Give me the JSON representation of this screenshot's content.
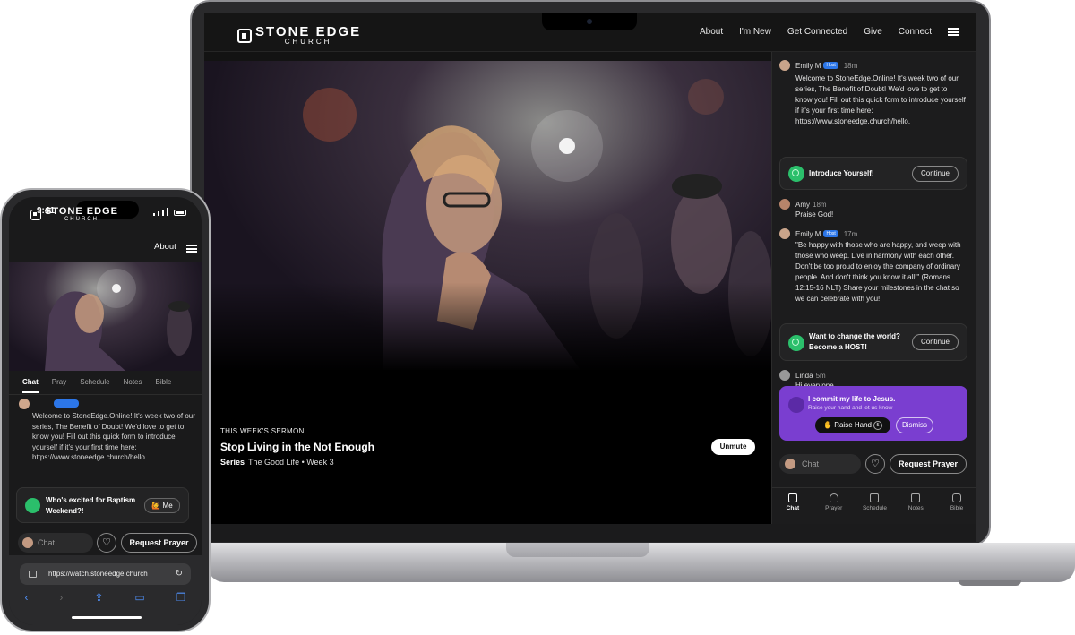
{
  "desktop": {
    "logo": {
      "line1": "STONE EDGE",
      "line2": "CHURCH"
    },
    "nav": [
      "About",
      "I'm New",
      "Get Connected",
      "Give",
      "Connect"
    ],
    "video": {
      "kicker": "THIS WEEK'S SERMON",
      "title": "Stop Living in the Not Enough",
      "series_label": "Series",
      "series_value": "The Good Life • Week 3",
      "unmute_label": "Unmute"
    },
    "chat": {
      "messages": [
        {
          "author": "Emily M",
          "badge": "Host",
          "time": "18m",
          "text": "Welcome to StoneEdge.Online! It's week two of our series, The Benefit of Doubt! We'd love to get to know you! Fill out this quick form to introduce yourself if it's your first time here: https://www.stoneedge.church/hello."
        },
        {
          "author": "Amy",
          "time": "18m",
          "text": "Praise God!"
        },
        {
          "author": "Emily M",
          "badge": "Host",
          "time": "17m",
          "text": "\"Be happy with those who are happy, and weep with those who weep. Live in harmony with each other. Don't be too proud to enjoy the company of ordinary people. And don't think you know it all!\" (Romans 12:15-16 NLT) Share your milestones in the chat so we can celebrate with you!"
        },
        {
          "author": "Linda",
          "time": "5m",
          "text": "Hi everyone"
        }
      ],
      "cards": [
        {
          "title": "Introduce Yourself!",
          "button": "Continue"
        },
        {
          "title": "Want to change the world? Become a HOST!",
          "button": "Continue"
        }
      ],
      "prayer_prompt": {
        "title": "I commit my life to Jesus.",
        "subtitle": "Raise your hand and let us know",
        "raise_label": "Raise Hand",
        "raise_count": "5",
        "dismiss_label": "Dismiss"
      },
      "input_placeholder": "Chat",
      "request_prayer_label": "Request Prayer",
      "tabs": [
        "Chat",
        "Prayer",
        "Schedule",
        "Notes",
        "Bible"
      ]
    }
  },
  "phone": {
    "time": "9:41",
    "logo": {
      "line1": "STONE EDGE",
      "line2": "CHURCH"
    },
    "nav_about": "About",
    "tabs": [
      "Chat",
      "Pray",
      "Schedule",
      "Notes",
      "Bible"
    ],
    "message": "Welcome to StoneEdge.Online! It's week two of our series, The Benefit of Doubt! We'd love to get to know you! Fill out this quick form to introduce yourself if it's your first time here: https://www.stoneedge.church/hello.",
    "card": {
      "title": "Who's excited for Baptism Weekend?!",
      "button": "Me"
    },
    "input_placeholder": "Chat",
    "request_prayer_label": "Request Prayer",
    "url": "https://watch.stoneedge.church"
  },
  "colors": {
    "accent_purple": "#7a3ed0",
    "host_blue": "#2c76e8",
    "green": "#2bbf6b"
  }
}
